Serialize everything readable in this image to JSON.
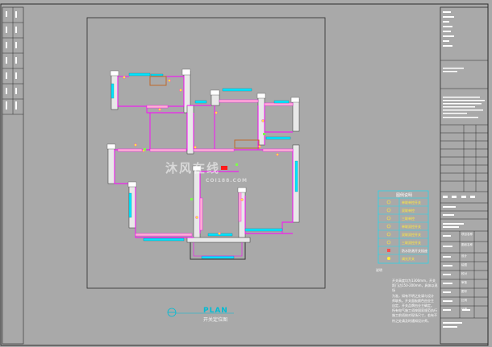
{
  "plan": {
    "title": "PLAN",
    "subtitle": "开关定位图"
  },
  "watermark": {
    "text": "沐风在线",
    "sub": "COI188.COM"
  },
  "legend": {
    "title": "图例说明",
    "items": [
      {
        "label": "单联单控开关",
        "symbol": "switch-single-icon"
      },
      {
        "label": "双联单控",
        "symbol": "switch-double-icon"
      },
      {
        "label": "三联单控",
        "symbol": "switch-triple-icon"
      },
      {
        "label": "单联双控开关",
        "symbol": "switch-two-way-icon"
      },
      {
        "label": "双联双控开关",
        "symbol": "switch-two-way-double-icon"
      },
      {
        "label": "三联双控开关",
        "symbol": "switch-two-way-triple-icon"
      },
      {
        "label": "防水防溅开关插座",
        "symbol": "splash-socket-icon"
      },
      {
        "label": "调光开关",
        "symbol": "dimmer-icon"
      }
    ]
  },
  "notes": {
    "head": "说明",
    "lines": [
      "开关高度均为1300mm，开关",
      "距门边150-200mm，具体以现场",
      "为准，如有不明之处请与设计",
      "师联系。开关面板颜色由业主",
      "自定，开关品牌由业主确定。",
      "所有电气施工须按国家规范执行",
      "施工前须核对现场尺寸，若有不",
      "符之处请及时通知设计师。"
    ]
  },
  "title_block": {
    "rows": [
      "项目名称",
      "图纸名称",
      "设计",
      "绘图",
      "校对",
      "审核",
      "图号",
      "比例",
      "日期"
    ]
  },
  "colors": {
    "background": "#a9a9a9",
    "wall": "#ff00ff",
    "window": "#00e5ff",
    "frame": "#2a2a2a",
    "wall_fill": "#e0e0e0"
  }
}
